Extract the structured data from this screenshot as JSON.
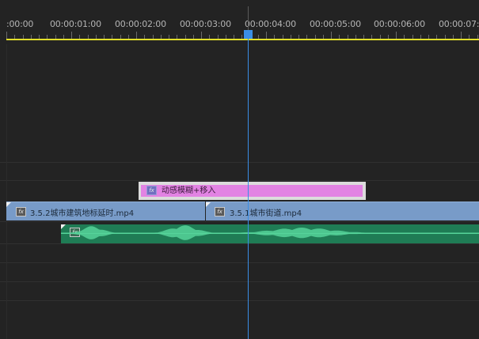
{
  "ruler": {
    "timecodes": [
      ":00:00",
      "00:00:01:00",
      "00:00:02:00",
      "00:00:03:00",
      "00:00:04:00",
      "00:00:05:00",
      "00:00:06:00",
      "00:00:07:0"
    ]
  },
  "tracks": {
    "transition": {
      "label": "动感模糊+移入",
      "fx": "fx"
    },
    "video_clips": [
      {
        "label": "3.5.2城市建筑地标延时.mp4",
        "fx": "fx"
      },
      {
        "label": "3.5.1城市街道.mp4",
        "fx": "fx"
      }
    ],
    "audio": {
      "fx": "fx"
    }
  },
  "colors": {
    "background": "#232323",
    "work_area": "#e2df2a",
    "playhead": "#3a8ee6",
    "video_clip": "#789bc8",
    "transition": "#e283e3",
    "audio_clip": "#1f7c55",
    "waveform": "#56d49a"
  }
}
